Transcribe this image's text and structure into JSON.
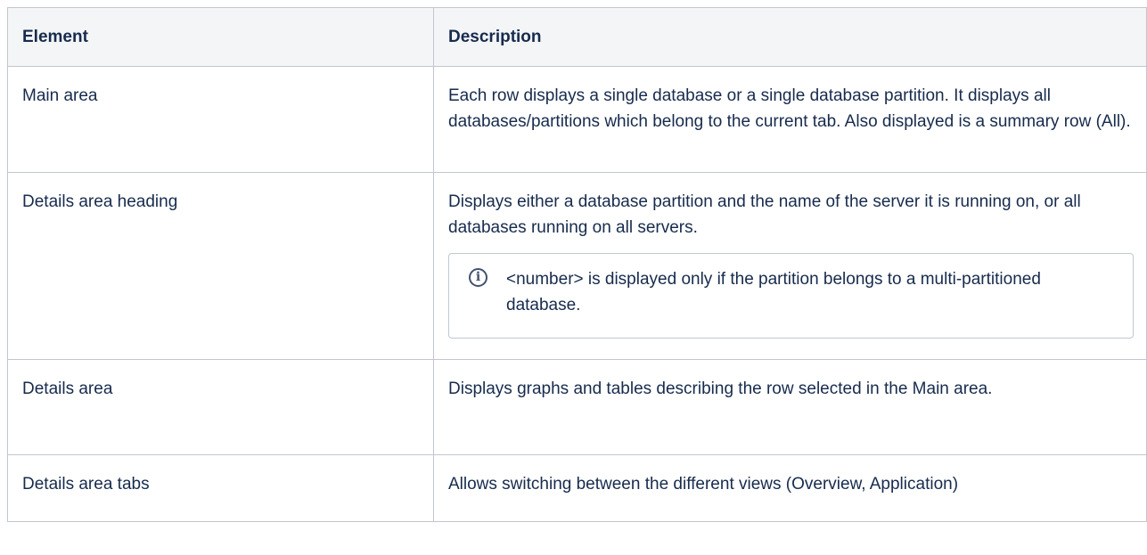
{
  "table": {
    "headers": [
      "Element",
      "Description"
    ],
    "rows": [
      {
        "element": "Main area",
        "description": "Each row displays a single database or a single database partition. It displays all databases/partitions which belong to the current tab. Also displayed is a summary row (All)."
      },
      {
        "element": "Details area heading",
        "description": "Displays either a database partition and the name of the server it is running on, or all databases running on all servers.",
        "note": {
          "icon": "info-icon",
          "text": "<number> is displayed only if the partition belongs to a multi-partitioned database."
        }
      },
      {
        "element": "Details area",
        "description": "Displays graphs and tables describing the row selected in the Main area."
      },
      {
        "element": "Details area tabs",
        "description": "Allows switching between the different views (Overview, Application)"
      }
    ]
  }
}
